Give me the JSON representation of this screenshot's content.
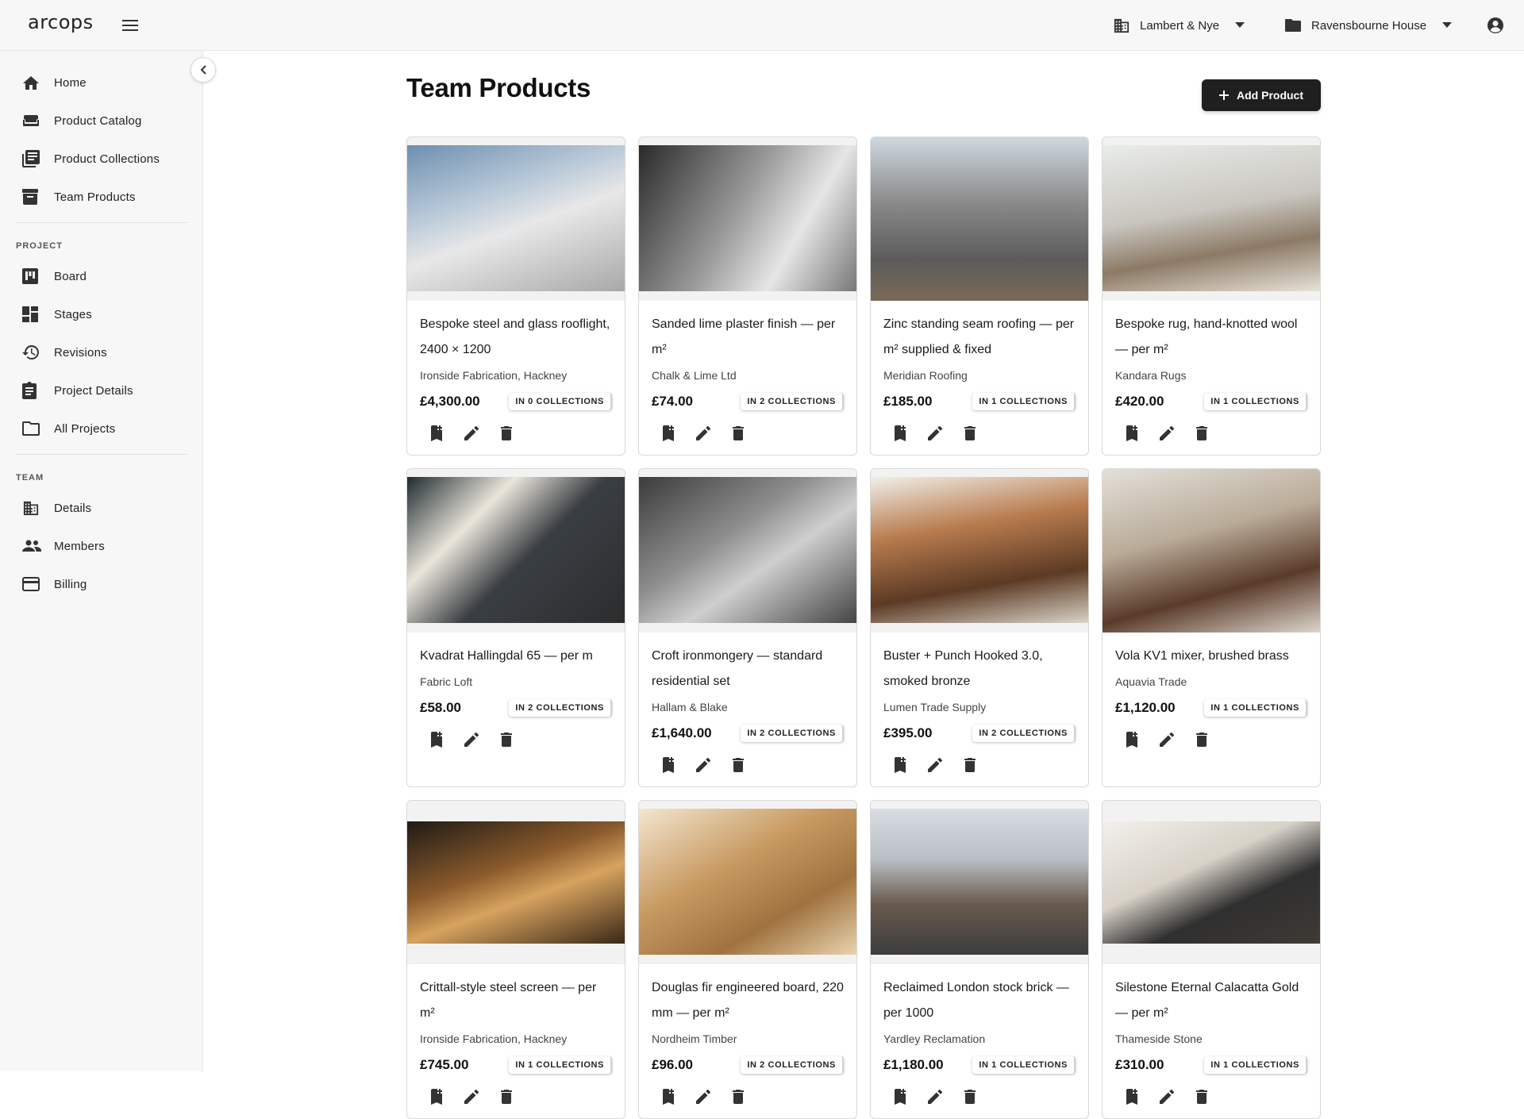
{
  "app": {
    "logo": "arcops"
  },
  "topbar": {
    "team_name": "Lambert & Nye",
    "project_name": "Ravensbourne House"
  },
  "sidebar": {
    "main_items": [
      {
        "label": "Home",
        "icon": "home-icon"
      },
      {
        "label": "Product Catalog",
        "icon": "sofa-icon"
      },
      {
        "label": "Product Collections",
        "icon": "library-icon"
      },
      {
        "label": "Team Products",
        "icon": "archive-icon"
      }
    ],
    "project_section": "PROJECT",
    "project_items": [
      {
        "label": "Board",
        "icon": "board-icon"
      },
      {
        "label": "Stages",
        "icon": "dashboard-icon"
      },
      {
        "label": "Revisions",
        "icon": "history-icon"
      },
      {
        "label": "Project Details",
        "icon": "assignment-icon"
      },
      {
        "label": "All Projects",
        "icon": "folder-icon"
      }
    ],
    "team_section": "TEAM",
    "team_items": [
      {
        "label": "Details",
        "icon": "building-icon"
      },
      {
        "label": "Members",
        "icon": "people-icon"
      },
      {
        "label": "Billing",
        "icon": "credit-card-icon"
      }
    ]
  },
  "main": {
    "title": "Team Products",
    "add_button": "Add Product"
  },
  "products": [
    {
      "title": "Bespoke steel and glass rooflight, 2400 × 1200",
      "supplier": "Ironside Fabrication, Hackney",
      "price": "£4,300.00",
      "collections": "IN 0 COLLECTIONS",
      "image": "rooflight-photo"
    },
    {
      "title": "Sanded lime plaster finish — per m²",
      "supplier": "Chalk & Lime Ltd",
      "price": "£74.00",
      "collections": "IN 2 COLLECTIONS",
      "image": "plastering-photo"
    },
    {
      "title": "Zinc standing seam roofing — per m² supplied & fixed",
      "supplier": "Meridian Roofing",
      "price": "£185.00",
      "collections": "IN 1 COLLECTIONS",
      "image": "scaffolding-photo"
    },
    {
      "title": "Bespoke rug, hand-knotted wool — per m²",
      "supplier": "Kandara Rugs",
      "price": "£420.00",
      "collections": "IN 1 COLLECTIONS",
      "image": "living-room-photo"
    },
    {
      "title": "Kvadrat Hallingdal 65 — per m",
      "supplier": "Fabric Loft",
      "price": "£58.00",
      "collections": "IN 2 COLLECTIONS",
      "image": "fabric-swatches-photo"
    },
    {
      "title": "Croft ironmongery — standard residential set",
      "supplier": "Hallam & Blake",
      "price": "£1,640.00",
      "collections": "IN 2 COLLECTIONS",
      "image": "carpentry-photo"
    },
    {
      "title": "Buster + Punch Hooked 3.0, smoked bronze",
      "supplier": "Lumen Trade Supply",
      "price": "£395.00",
      "collections": "IN 2 COLLECTIONS",
      "image": "dining-room-photo"
    },
    {
      "title": "Vola KV1 mixer, brushed brass",
      "supplier": "Aquavia Trade",
      "price": "£1,120.00",
      "collections": "IN 1 COLLECTIONS",
      "image": "bathroom-photo"
    },
    {
      "title": "Crittall-style steel screen — per m²",
      "supplier": "Ironside Fabrication, Hackney",
      "price": "£745.00",
      "collections": "IN 1 COLLECTIONS",
      "image": "loft-interior-photo"
    },
    {
      "title": "Douglas fir engineered board, 220 mm — per m²",
      "supplier": "Nordheim Timber",
      "price": "£96.00",
      "collections": "IN 2 COLLECTIONS",
      "image": "timber-photo"
    },
    {
      "title": "Reclaimed London stock brick — per 1000",
      "supplier": "Yardley Reclamation",
      "price": "£1,180.00",
      "collections": "IN 1 COLLECTIONS",
      "image": "terraced-houses-photo"
    },
    {
      "title": "Silestone Eternal Calacatta Gold — per m²",
      "supplier": "Thameside Stone",
      "price": "£310.00",
      "collections": "IN 1 COLLECTIONS",
      "image": "kitchen-photo"
    }
  ],
  "colors": {
    "button_dark": "#1f1f1f",
    "sidebar_bg": "#f7f7f7",
    "border": "#d9d9d9"
  }
}
